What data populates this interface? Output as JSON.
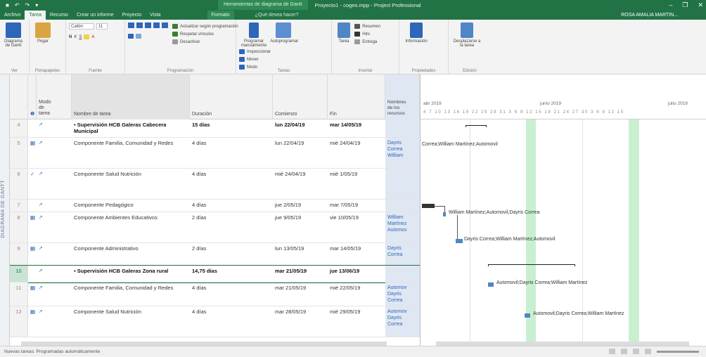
{
  "window": {
    "context_label": "Herramientas de diagrama de Gantt",
    "document_title": "Proyecto1 - cogeo.mpp - Project Professional",
    "user": "ROSA AMALIA MARTIN...",
    "controls": [
      "–",
      "❐",
      "✕"
    ]
  },
  "tabs": [
    "Archivo",
    "Tarea",
    "Recurso",
    "Crear un informe",
    "Proyecto",
    "Vista"
  ],
  "format_tab": "Formato",
  "search_hint": "¿Qué desea hacer?",
  "ribbon": {
    "groups": {
      "vista": "Ver",
      "portapapeles": "Portapapeles",
      "fuente": "Fuente",
      "programacion": "Programación",
      "tareas": "Tareas",
      "insertar": "Insertar",
      "propiedades": "Propiedades",
      "edicion": "Edición"
    },
    "diagrama_gantt": "Diagrama de Gantt",
    "pegar": "Pegar",
    "font_name": "Calibri",
    "font_size": "11",
    "actualizar": "Actualizar según programación",
    "respetar": "Respetar vínculos",
    "desactivar": "Desactivar",
    "programar_manual": "Programar manualmente",
    "autoprogramar": "Autoprogramar",
    "inspeccionar": "Inspeccionar",
    "mover": "Mover",
    "modo": "Modo",
    "tarea": "Tarea",
    "resumen": "Resumen",
    "hito": "Hito",
    "entrega": "Entrega",
    "informacion": "Información",
    "desplazarse": "Desplazarse a la tarea"
  },
  "side_label": "DIAGRAMA DE GANTT",
  "columns": {
    "modo": "Modo de tarea",
    "nombre": "Nombre de tarea",
    "duracion": "Duración",
    "comienzo": "Comienzo",
    "fin": "Fin",
    "recursos": "Nombres de los recursos"
  },
  "rows": [
    {
      "id": "4",
      "ind": "",
      "name": "▪ Supervisión HCB Galeras Cabecera Municipal",
      "dur": "15 días",
      "start": "lun 22/04/19",
      "end": "mar 14/05/19",
      "res": "",
      "summary": true
    },
    {
      "id": "5",
      "ind": "▦",
      "name": "Componente Familia, Comunidad y Redes",
      "dur": "4 días",
      "start": "lun 22/04/19",
      "end": "mié 24/04/19",
      "res": "Dayris Correa William",
      "summary": false
    },
    {
      "id": "6",
      "ind": "✓",
      "name": "Componente Salud Nutrición",
      "dur": "4 días",
      "start": "mié 24/04/19",
      "end": "mié 1/05/19",
      "res": "",
      "summary": false
    },
    {
      "id": "7",
      "ind": "",
      "name": "Componente Pedagógico",
      "dur": "4 días",
      "start": "jue 2/05/19",
      "end": "mar 7/05/19",
      "res": "",
      "summary": false
    },
    {
      "id": "8",
      "ind": "▦",
      "name": "Componente Ambientes Educativos",
      "dur": "2 días",
      "start": "jue 9/05/19",
      "end": "vie 10/05/19",
      "res": "William Martínez Automov",
      "summary": false
    },
    {
      "id": "9",
      "ind": "▦",
      "name": "Componente Administrativo",
      "dur": "2 días",
      "start": "lun 13/05/19",
      "end": "mar 14/05/19",
      "res": "Dayris Correa",
      "summary": false
    },
    {
      "id": "10",
      "ind": "",
      "name": "▪ Supervisión HCB Galeras Zona rural",
      "dur": "14,75 días",
      "start": "mar 21/05/19",
      "end": "jue 13/06/19",
      "res": "",
      "summary": true
    },
    {
      "id": "11",
      "ind": "▦",
      "name": "Componente Familia, Comunidad y Redes",
      "dur": "4 días",
      "start": "mar 21/05/19",
      "end": "mié 22/05/19",
      "res": "Automov Dayris Correa",
      "summary": false
    },
    {
      "id": "12",
      "ind": "▦",
      "name": "Componente Salud Nutrición",
      "dur": "4 días",
      "start": "mar 28/05/19",
      "end": "mié 29/05/19",
      "res": "Automov Dayris Correa",
      "summary": false
    }
  ],
  "gantt": {
    "months": [
      "abr 2019",
      "junio 2019",
      "julio 2019"
    ],
    "days": "4  7  10 13 16 19 22 25 28 31  3  6  9  12 15 18 21 24 27 30  3  6  9  12 15",
    "labels": {
      "r5": "Correa;William Martínez;Automovil",
      "r8": "William Martínez;Automovil;Dayris Correa",
      "r9": "Dayris Correa;William Martínez;Automovil",
      "r11": "Automovil;Dayris Correa;William Martínez",
      "r12": "Automovil;Dayris Correa;William Martínez"
    }
  },
  "status": {
    "left": "Nuevas tareas: Programadas automáticamente"
  }
}
